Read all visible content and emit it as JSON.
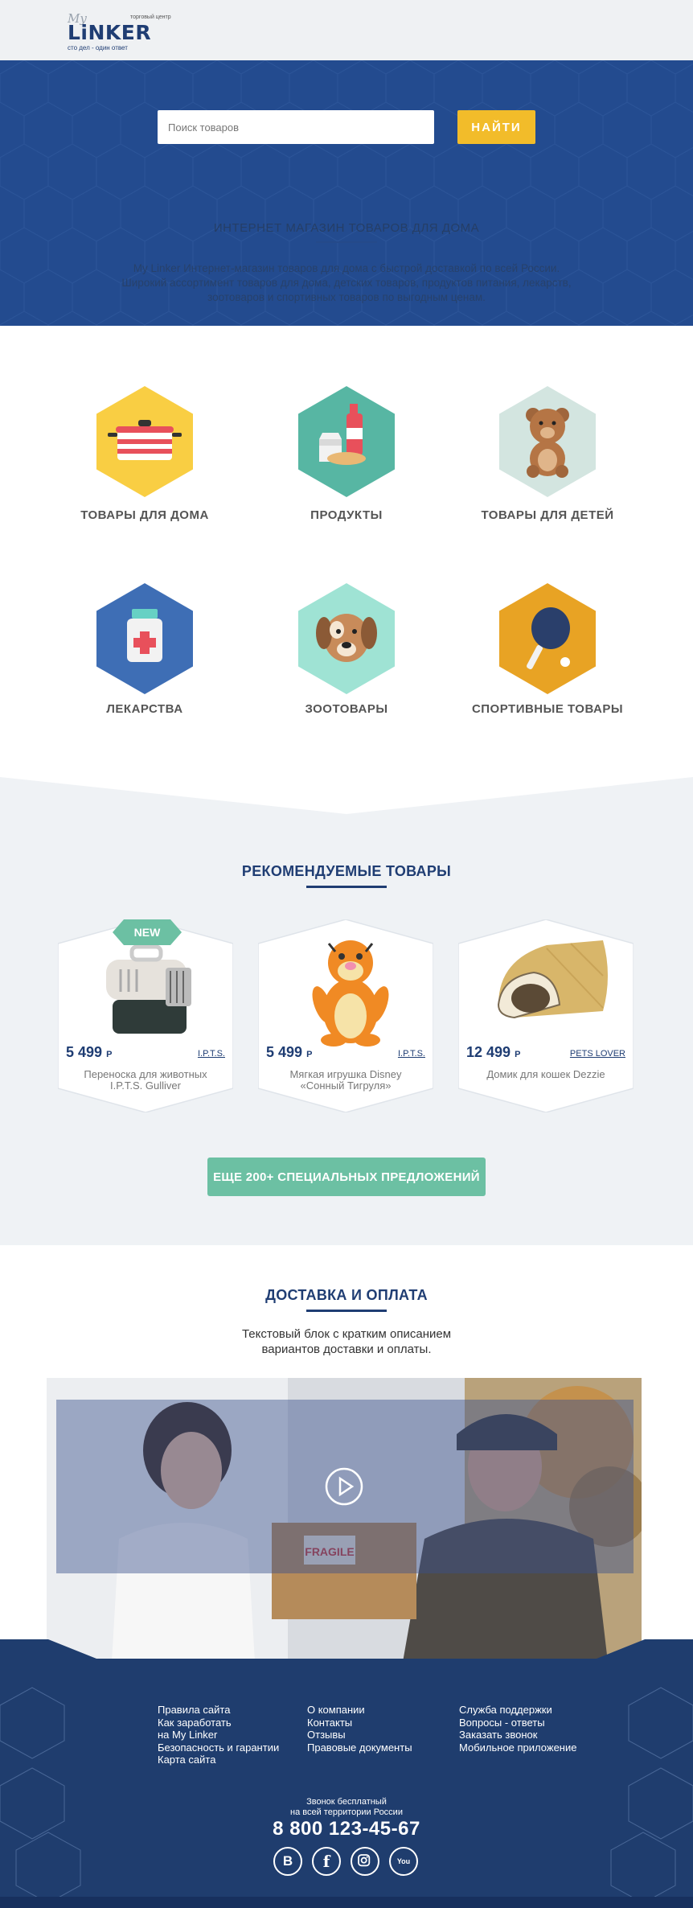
{
  "header": {
    "logo_my": "My",
    "logo_brand": "LiNKER",
    "logo_tag_top": "торговый центр",
    "logo_tag_bottom": "сто дел - один ответ"
  },
  "search": {
    "placeholder": "Поиск товаров",
    "button_label": "НАЙТИ"
  },
  "hero": {
    "title": "ИНТЕРНЕТ МАГАЗИН ТОВАРОВ ДЛЯ ДОМА",
    "description": "My Linker Интернет-магазин товаров для дома с быстрой доставкой по всей России. Широкий ассортимент товаров для дома, детских товаров, продуктов питания, лекарств, зоотоваров и спортивных товаров по выгодным ценам."
  },
  "categories": [
    {
      "label": "ТОВАРЫ ДЛЯ ДОМА",
      "icon": "pot-icon",
      "color": "#f9ce43"
    },
    {
      "label": "ПРОДУКТЫ",
      "icon": "groceries-icon",
      "color": "#57b6a3"
    },
    {
      "label": "ТОВАРЫ ДЛЯ ДЕТЕЙ",
      "icon": "teddy-bear-icon",
      "color": "#d3e5e0"
    },
    {
      "label": "ЛЕКАРСТВА",
      "icon": "medicine-icon",
      "color": "#3e6eb5"
    },
    {
      "label": "ЗООТОВАРЫ",
      "icon": "dog-icon",
      "color": "#9fe3d4"
    },
    {
      "label": "СПОРТИВНЫЕ ТОВАРЫ",
      "icon": "ping-pong-icon",
      "color": "#e8a324"
    }
  ],
  "recommended": {
    "title": "РЕКОМЕНДУЕМЫЕ ТОВАРЫ",
    "badge": "NEW",
    "currency": "Р",
    "products": [
      {
        "price": "5 499",
        "brand": "I.P.T.S.",
        "name": "Переноска для животных I.P.T.S. Gulliver",
        "icon": "pet-carrier-icon"
      },
      {
        "price": "5 499",
        "brand": "I.P.T.S.",
        "name": "Мягкая игрушка Disney «Сонный Тигруля»",
        "icon": "tigger-toy-icon"
      },
      {
        "price": "12 499",
        "brand": "PETS LOVER",
        "name": "Домик для кошек Dezzie",
        "icon": "cat-house-icon"
      }
    ],
    "more_button": "ЕЩЕ 200+ СПЕЦИАЛЬНЫХ ПРЕДЛОЖЕНИЙ"
  },
  "delivery": {
    "title": "ДОСТАВКА И ОПЛАТА",
    "text_line1": "Текстовый блок с кратким описанием",
    "text_line2": "вариантов доставки и оплаты.",
    "box_label": "FRAGILE",
    "play_icon": "play-icon"
  },
  "footer": {
    "col1": [
      "Правила сайта",
      "Как заработать",
      "на My Linker",
      "Безопасность и гарантии",
      "Карта сайта"
    ],
    "col2": [
      "О компании",
      "Контакты",
      "Отзывы",
      "Правовые документы"
    ],
    "col3": [
      "Служба поддержки",
      "Вопросы - ответы",
      "Заказать звонок",
      "Мобильное приложение"
    ],
    "free_call_line1": "Звонок бесплатный",
    "free_call_line2": "на всей территории России",
    "phone": "8 800 123-45-67",
    "socials": [
      {
        "icon": "vk-icon",
        "glyph": "B"
      },
      {
        "icon": "facebook-icon",
        "glyph": "f"
      },
      {
        "icon": "instagram-icon",
        "glyph": ""
      },
      {
        "icon": "youtube-icon",
        "glyph": "You"
      }
    ]
  },
  "colors": {
    "primary": "#1f3d73",
    "hero": "#234b8f",
    "accent_yellow": "#f2bc2a",
    "accent_green": "#6cc0a3",
    "footer": "#1f3d6e"
  }
}
